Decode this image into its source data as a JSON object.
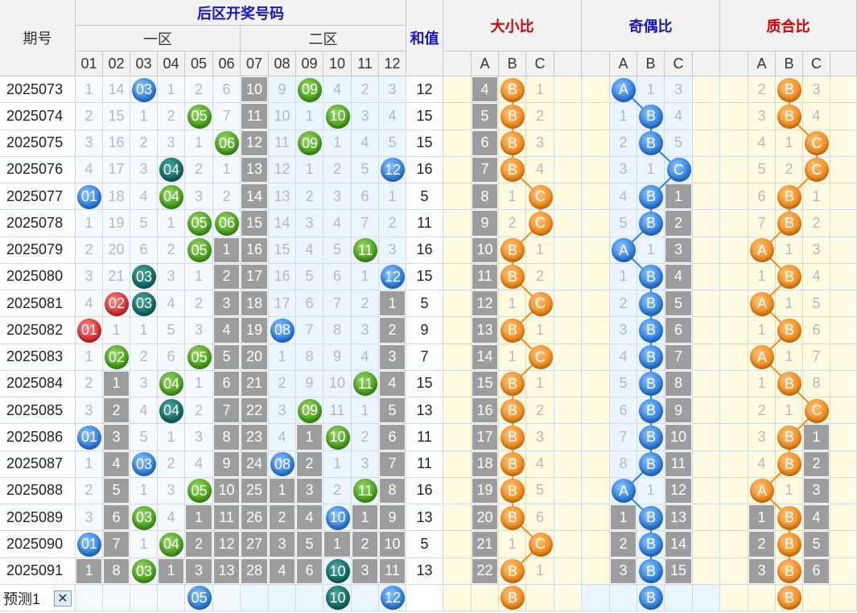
{
  "header": {
    "issue_label": "期号",
    "back_title": "后区开奖号码",
    "zone1": "一区",
    "zone2": "二区",
    "sum_label": "和值",
    "bigsmall": "大小比",
    "oddeven": "奇偶比",
    "primecomp": "质合比",
    "abc": [
      "A",
      "B",
      "C"
    ],
    "nums": [
      "01",
      "02",
      "03",
      "04",
      "05",
      "06",
      "07",
      "08",
      "09",
      "10",
      "11",
      "12"
    ]
  },
  "rows": [
    {
      "issue": "2025073",
      "balls": [
        "03",
        "09"
      ],
      "miss": [
        "1",
        "14",
        "03",
        "1",
        "2",
        "6",
        "10",
        "9",
        "09",
        "4",
        "2",
        "3"
      ],
      "sum": "12",
      "bs": [
        "4",
        "B",
        "1"
      ],
      "oe": [
        "A",
        "1",
        "3"
      ],
      "pc": [
        "2",
        "B",
        "3"
      ]
    },
    {
      "issue": "2025074",
      "balls": [
        "05",
        "10"
      ],
      "miss": [
        "2",
        "15",
        "1",
        "2",
        "05",
        "7",
        "11",
        "10",
        "1",
        "10",
        "3",
        "4"
      ],
      "sum": "15",
      "bs": [
        "5",
        "B",
        "2"
      ],
      "oe": [
        "1",
        "B",
        "4"
      ],
      "pc": [
        "3",
        "B",
        "4"
      ]
    },
    {
      "issue": "2025075",
      "balls": [
        "06",
        "09"
      ],
      "miss": [
        "3",
        "16",
        "2",
        "3",
        "1",
        "06",
        "12",
        "11",
        "09",
        "1",
        "4",
        "5"
      ],
      "sum": "15",
      "bs": [
        "6",
        "B",
        "3"
      ],
      "oe": [
        "2",
        "B",
        "5"
      ],
      "pc": [
        "4",
        "1",
        "C"
      ]
    },
    {
      "issue": "2025076",
      "balls": [
        "04",
        "12"
      ],
      "miss": [
        "4",
        "17",
        "3",
        "04",
        "2",
        "1",
        "13",
        "12",
        "1",
        "2",
        "5",
        "12"
      ],
      "sum": "16",
      "bs": [
        "7",
        "B",
        "4"
      ],
      "oe": [
        "3",
        "1",
        "C"
      ],
      "pc": [
        "5",
        "2",
        "C"
      ]
    },
    {
      "issue": "2025077",
      "balls": [
        "01",
        "04"
      ],
      "miss": [
        "01",
        "18",
        "4",
        "04",
        "3",
        "2",
        "14",
        "13",
        "2",
        "3",
        "6",
        "1"
      ],
      "sum": "5",
      "bs": [
        "8",
        "1",
        "C"
      ],
      "oe": [
        "4",
        "B",
        "1"
      ],
      "pc": [
        "6",
        "B",
        "1"
      ]
    },
    {
      "issue": "2025078",
      "balls": [
        "05",
        "06"
      ],
      "miss": [
        "1",
        "19",
        "5",
        "1",
        "05",
        "06",
        "15",
        "14",
        "3",
        "4",
        "7",
        "2"
      ],
      "sum": "11",
      "bs": [
        "9",
        "2",
        "C"
      ],
      "oe": [
        "5",
        "B",
        "2"
      ],
      "pc": [
        "7",
        "B",
        "2"
      ]
    },
    {
      "issue": "2025079",
      "balls": [
        "05",
        "11"
      ],
      "miss": [
        "2",
        "20",
        "6",
        "2",
        "05",
        "1",
        "16",
        "15",
        "4",
        "5",
        "11",
        "3"
      ],
      "sum": "16",
      "bs": [
        "10",
        "B",
        "1"
      ],
      "oe": [
        "A",
        "1",
        "3"
      ],
      "pc": [
        "A",
        "1",
        "3"
      ]
    },
    {
      "issue": "2025080",
      "balls": [
        "03",
        "12"
      ],
      "miss": [
        "3",
        "21",
        "03",
        "3",
        "1",
        "2",
        "17",
        "16",
        "5",
        "6",
        "1",
        "12"
      ],
      "sum": "15",
      "bs": [
        "11",
        "B",
        "2"
      ],
      "oe": [
        "1",
        "B",
        "4"
      ],
      "pc": [
        "1",
        "B",
        "4"
      ]
    },
    {
      "issue": "2025081",
      "balls": [
        "02",
        "03"
      ],
      "miss": [
        "4",
        "02",
        "03",
        "4",
        "2",
        "3",
        "18",
        "17",
        "6",
        "7",
        "2",
        "1"
      ],
      "sum": "5",
      "bs": [
        "12",
        "1",
        "C"
      ],
      "oe": [
        "2",
        "B",
        "5"
      ],
      "pc": [
        "A",
        "1",
        "5"
      ]
    },
    {
      "issue": "2025082",
      "balls": [
        "01",
        "08"
      ],
      "miss": [
        "01",
        "1",
        "1",
        "5",
        "3",
        "4",
        "19",
        "08",
        "7",
        "8",
        "3",
        "2"
      ],
      "sum": "9",
      "bs": [
        "13",
        "B",
        "1"
      ],
      "oe": [
        "3",
        "B",
        "6"
      ],
      "pc": [
        "1",
        "B",
        "6"
      ]
    },
    {
      "issue": "2025083",
      "balls": [
        "02",
        "05"
      ],
      "miss": [
        "1",
        "02",
        "2",
        "6",
        "05",
        "5",
        "20",
        "1",
        "8",
        "9",
        "4",
        "3"
      ],
      "sum": "7",
      "bs": [
        "14",
        "1",
        "C"
      ],
      "oe": [
        "4",
        "B",
        "7"
      ],
      "pc": [
        "A",
        "1",
        "7"
      ]
    },
    {
      "issue": "2025084",
      "balls": [
        "04",
        "11"
      ],
      "miss": [
        "2",
        "1",
        "3",
        "04",
        "1",
        "6",
        "21",
        "2",
        "9",
        "10",
        "11",
        "4"
      ],
      "sum": "15",
      "bs": [
        "15",
        "B",
        "1"
      ],
      "oe": [
        "5",
        "B",
        "8"
      ],
      "pc": [
        "1",
        "B",
        "8"
      ]
    },
    {
      "issue": "2025085",
      "balls": [
        "04",
        "09"
      ],
      "miss": [
        "3",
        "2",
        "4",
        "04",
        "2",
        "7",
        "22",
        "3",
        "09",
        "11",
        "1",
        "5"
      ],
      "sum": "13",
      "bs": [
        "16",
        "B",
        "2"
      ],
      "oe": [
        "6",
        "B",
        "9"
      ],
      "pc": [
        "2",
        "1",
        "C"
      ]
    },
    {
      "issue": "2025086",
      "balls": [
        "01",
        "10"
      ],
      "miss": [
        "01",
        "3",
        "5",
        "1",
        "3",
        "8",
        "23",
        "4",
        "1",
        "10",
        "2",
        "6"
      ],
      "sum": "11",
      "bs": [
        "17",
        "B",
        "3"
      ],
      "oe": [
        "7",
        "B",
        "10"
      ],
      "pc": [
        "3",
        "B",
        "1"
      ]
    },
    {
      "issue": "2025087",
      "balls": [
        "03",
        "08"
      ],
      "miss": [
        "1",
        "4",
        "03",
        "2",
        "4",
        "9",
        "24",
        "08",
        "2",
        "1",
        "3",
        "7"
      ],
      "sum": "11",
      "bs": [
        "18",
        "B",
        "4"
      ],
      "oe": [
        "8",
        "B",
        "11"
      ],
      "pc": [
        "4",
        "B",
        "2"
      ]
    },
    {
      "issue": "2025088",
      "balls": [
        "05",
        "11"
      ],
      "miss": [
        "2",
        "5",
        "1",
        "3",
        "05",
        "10",
        "25",
        "1",
        "3",
        "2",
        "11",
        "8"
      ],
      "sum": "16",
      "bs": [
        "19",
        "B",
        "5"
      ],
      "oe": [
        "A",
        "1",
        "12"
      ],
      "pc": [
        "A",
        "1",
        "3"
      ]
    },
    {
      "issue": "2025089",
      "balls": [
        "03",
        "10"
      ],
      "miss": [
        "3",
        "6",
        "03",
        "4",
        "1",
        "11",
        "26",
        "2",
        "4",
        "10",
        "1",
        "9"
      ],
      "sum": "13",
      "bs": [
        "20",
        "B",
        "6"
      ],
      "oe": [
        "1",
        "B",
        "13"
      ],
      "pc": [
        "1",
        "B",
        "4"
      ]
    },
    {
      "issue": "2025090",
      "balls": [
        "01",
        "04"
      ],
      "miss": [
        "01",
        "7",
        "1",
        "04",
        "2",
        "12",
        "27",
        "3",
        "5",
        "1",
        "2",
        "10"
      ],
      "sum": "5",
      "bs": [
        "21",
        "1",
        "C"
      ],
      "oe": [
        "2",
        "B",
        "14"
      ],
      "pc": [
        "2",
        "B",
        "5"
      ]
    },
    {
      "issue": "2025091",
      "balls": [
        "03",
        "10"
      ],
      "miss": [
        "1",
        "8",
        "03",
        "1",
        "3",
        "13",
        "28",
        "4",
        "6",
        "10",
        "3",
        "11"
      ],
      "sum": "13",
      "bs": [
        "22",
        "B",
        "1"
      ],
      "oe": [
        "3",
        "B",
        "15"
      ],
      "pc": [
        "3",
        "B",
        "6"
      ]
    }
  ],
  "predict": {
    "label": "预测1",
    "close": "✕",
    "balls": [
      "05",
      "10",
      "12"
    ],
    "bs": "B",
    "oe": "B",
    "pc": "B"
  },
  "colors": {
    "blue": "#2f7fe0",
    "green": "#4aa31c",
    "teal": "#156c66",
    "red": "#d63030",
    "orange": "#f28c1c",
    "grey": "#9d9d9d"
  }
}
